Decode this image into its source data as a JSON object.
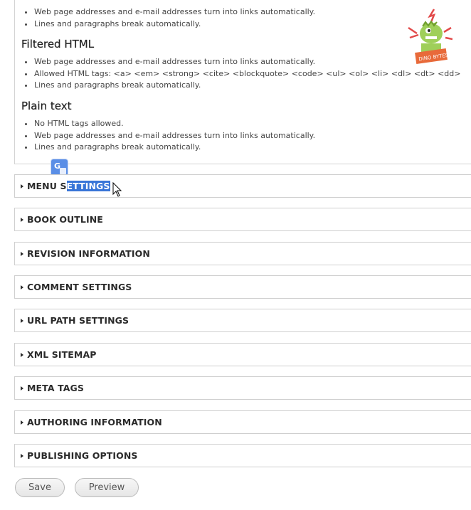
{
  "text_formats": {
    "group1_tips": [
      "Web page addresses and e-mail addresses turn into links automatically.",
      "Lines and paragraphs break automatically."
    ],
    "filtered_html": {
      "title": "Filtered HTML",
      "tips": [
        "Web page addresses and e-mail addresses turn into links automatically.",
        "Allowed HTML tags: <a> <em> <strong> <cite> <blockquote> <code> <ul> <ol> <li> <dl> <dt> <dd>",
        "Lines and paragraphs break automatically."
      ]
    },
    "plain_text": {
      "title": "Plain text",
      "tips": [
        "No HTML tags allowed.",
        "Web page addresses and e-mail addresses turn into links automatically.",
        "Lines and paragraphs break automatically."
      ]
    }
  },
  "fieldsets": {
    "menu_settings": {
      "prefix": "MENU S",
      "selected": "ETTINGS"
    },
    "book_outline": "BOOK OUTLINE",
    "revision_information": "REVISION INFORMATION",
    "comment_settings": "COMMENT SETTINGS",
    "url_path_settings": "URL PATH SETTINGS",
    "xml_sitemap": "XML SITEMAP",
    "meta_tags": "META TAGS",
    "authoring_information": "AUTHORING INFORMATION",
    "publishing_options": "PUBLISHING OPTIONS"
  },
  "actions": {
    "save": "Save",
    "preview": "Preview"
  },
  "translate_icon": {
    "name": "google-translate-icon",
    "letter": "G"
  },
  "colors": {
    "selection": "#3875d7",
    "mascot": "#9fcf5a"
  }
}
